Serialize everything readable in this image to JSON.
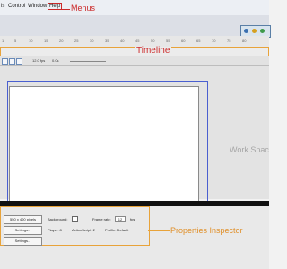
{
  "menubar": {
    "items": [
      {
        "label": "ls"
      },
      {
        "label": "Control"
      },
      {
        "label": "Window"
      },
      {
        "label": "Help"
      }
    ]
  },
  "annotations": {
    "menus": "Menus",
    "timeline": "Timeline",
    "work_space": "Work Spac",
    "properties_inspector": "Properties Inspector"
  },
  "ruler": {
    "ticks": [
      "1",
      "5",
      "10",
      "15",
      "20",
      "25",
      "30",
      "35",
      "40",
      "45",
      "50",
      "55",
      "60",
      "65",
      "70",
      "75",
      "80"
    ]
  },
  "timeline_status": {
    "fps": "12.0 fps",
    "time": "0.0s"
  },
  "properties": {
    "size_button": "550 x 400 pixels",
    "settings_button_1": "Settings...",
    "settings_button_2": "Settings...",
    "background_label": "Background:",
    "frame_rate_label": "Frame rate:",
    "frame_rate_value": "12",
    "fps_unit": "fps",
    "player_label": "Player: 8",
    "actionscript_label": "ActionScript: 2",
    "profile_label": "Profile: Default"
  },
  "colors": {
    "callout_red": "#cc2a2a",
    "callout_orange": "#e8a33a",
    "stage_outline_blue": "#4a5fd0"
  }
}
